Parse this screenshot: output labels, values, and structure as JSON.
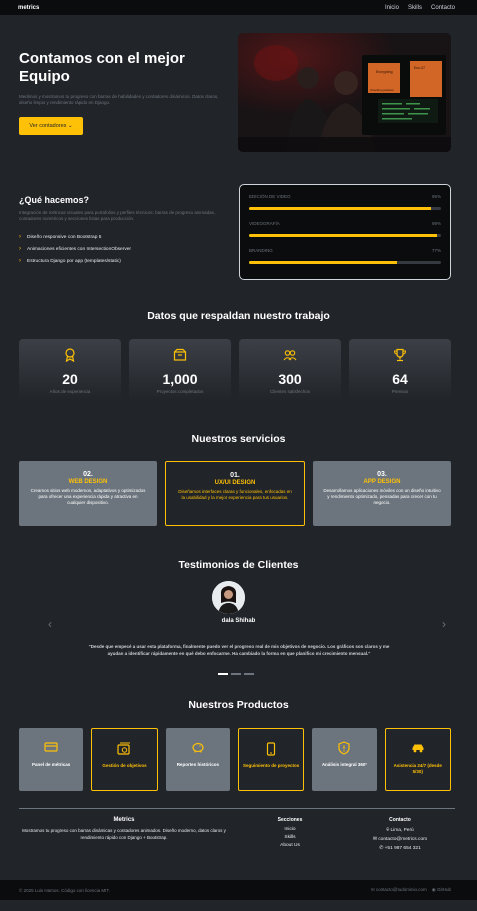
{
  "nav": {
    "brand": "metrics",
    "links": [
      "Inicio",
      "Skills",
      "Contacto"
    ]
  },
  "hero": {
    "title": "Contamos con el mejor Equipo",
    "subtitle": "Medimos y mostramos tu progreso con barras de habilidades y contadores dinámicos. Datos claros, diseño limpio y rendimiento rápido en Django.",
    "button": "Ver contadores ⌄",
    "image_labels": [
      "Encrypting",
      "Enc-07",
      "Checking packets"
    ]
  },
  "what": {
    "title": "¿Qué hacemos?",
    "subtitle": "Integración de métricas visuales para portafolios y perfiles técnicos: barras de progreso animadas, contadores numéricos y secciones listas para producción.",
    "items": [
      "Diseño responsive con Bootstrap 5",
      "Animaciones eficientes con IntersectionObserver",
      "Estructura Django por app (templates/static)"
    ]
  },
  "skills": [
    {
      "label": "EDICIÓN DE VIDEO",
      "value": "95%",
      "level": 0.95
    },
    {
      "label": "VIDEOGRAFÍA",
      "value": "98%",
      "level": 0.98
    },
    {
      "label": "BRANDING",
      "value": "77%",
      "level": 0.77
    }
  ],
  "stats": {
    "title": "Datos que respaldan nuestro trabajo",
    "items": [
      {
        "icon": "award-icon",
        "num": "20",
        "label": "Años de experiencia"
      },
      {
        "icon": "box-icon",
        "num": "1,000",
        "label": "Proyectos completados"
      },
      {
        "icon": "people-icon",
        "num": "300",
        "label": "Clientes satisfechos"
      },
      {
        "icon": "trophy-icon",
        "num": "64",
        "label": "Premios"
      }
    ]
  },
  "services": {
    "title": "Nuestros servicios",
    "items": [
      {
        "num": "02.",
        "name": "WEB DESIGN",
        "desc": "Creamos sitios web modernos, adaptativos y optimizados para ofrecer una experiencia rápida y atractiva en cualquier dispositivo."
      },
      {
        "num": "01.",
        "name": "UX/UI DESIGN",
        "desc": "Diseñamos interfaces claras y funcionales, enfocadas en la usabilidad y la mejor experiencia para tus usuarios."
      },
      {
        "num": "03.",
        "name": "APP DESIGN",
        "desc": "Desarrollamos aplicaciones móviles con un diseño intuitivo y rendimiento optimizado, pensadas para crecer con tu negocio."
      }
    ]
  },
  "testimonials": {
    "title": "Testimonios de Clientes",
    "name": "dala Shihab",
    "quote": "\"Desde que empecé a usar esta plataforma, finalmente puedo ver el progreso real de mis objetivos de negocio. Los gráficos son claros y me ayudan a identificar rápidamente en qué debo enfocarme. Ha cambiado la forma en que planifico mi crecimiento mensual.\"",
    "prev": "‹",
    "next": "›"
  },
  "products": {
    "title": "Nuestros Productos",
    "items": [
      {
        "icon": "card-icon",
        "name": "Panel de métricas"
      },
      {
        "icon": "money-icon",
        "name": "Gestión de objetivos"
      },
      {
        "icon": "piggy-icon",
        "name": "Reportes históricos"
      },
      {
        "icon": "phone-icon",
        "name": "Seguimiento de proyectos"
      },
      {
        "icon": "shield-icon",
        "name": "Análisis integral 360°"
      },
      {
        "icon": "car-icon",
        "name": "Asistencia 24/7 (desde 5/30)"
      }
    ]
  },
  "footer": {
    "brand": "Metrics",
    "desc": "Mostramos tu progreso con barras dinámicas y contadores animados. Diseño moderno, datos claros y rendimiento rápido con Django + Bootstrap.",
    "sections_title": "Secciones",
    "sections": [
      "Inicio",
      "Skills",
      "About Us"
    ],
    "contact_title": "Contacto",
    "location": "Lima, Perú",
    "email": "contacto@metrics.com",
    "phone": "+51 987 654 321"
  },
  "bottom": {
    "copyright": "© 2025 Luis Hamos. Código con licencia MIT.",
    "email": "contacto@tudominio.com",
    "github": "GitHub"
  },
  "colors": {
    "accent": "#ffc107",
    "bg": "#212429",
    "dark": "#0b0c0e",
    "card": "#6c757d"
  }
}
